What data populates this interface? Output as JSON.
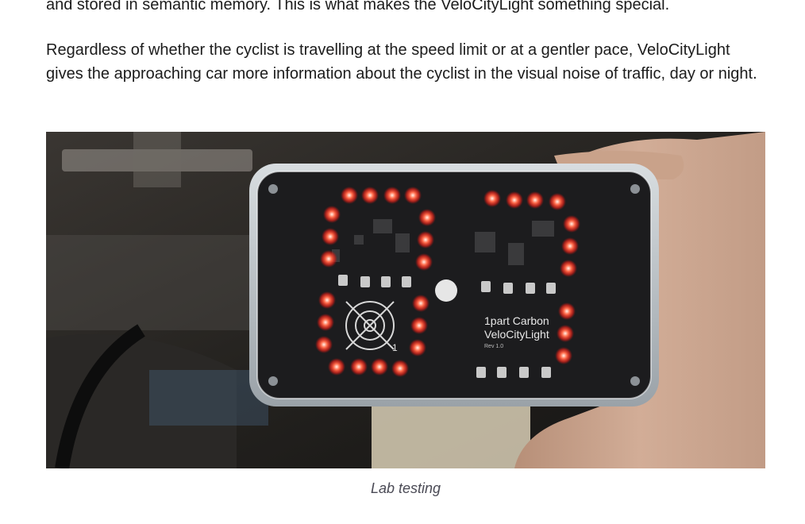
{
  "article": {
    "paragraph_top": "and stored in semantic memory.  This is what makes the VeloCityLight something special.",
    "paragraph_main": "Regardless of whether the cyclist is travelling at the speed limit or at a gentler pace, VeloCityLight gives the approaching car more information about the cyclist in the visual noise of traffic, day or night."
  },
  "figure": {
    "pcb_brand": "1part Carbon",
    "pcb_product": "VeloCityLight",
    "pcb_rev": "Rev 1.0",
    "pcb_mark": "1",
    "caption": "Lab testing"
  }
}
